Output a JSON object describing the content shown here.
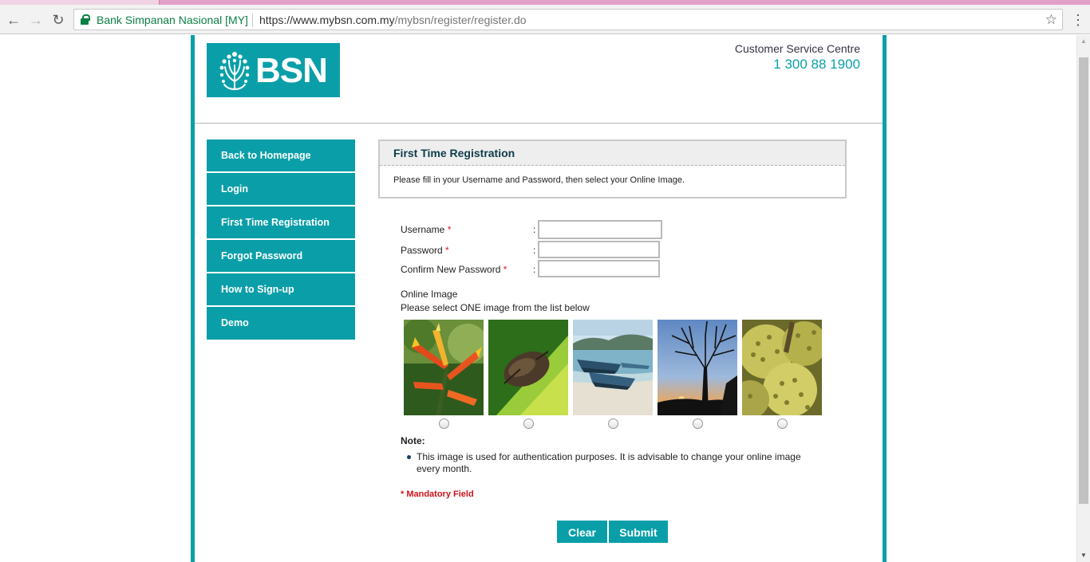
{
  "browser": {
    "site_name": "Bank Simpanan Nasional [MY]",
    "url_host": "https://www.mybsn.com.my",
    "url_path": "/mybsn/register/register.do",
    "back_icon": "arrow-left-icon",
    "forward_icon": "arrow-right-icon",
    "reload_icon": "reload-icon",
    "bookmark_icon": "star-icon",
    "menu_icon": "vertical-dots-icon",
    "secure_icon": "lock-icon"
  },
  "header": {
    "logo_text": "BSN",
    "cs_label": "Customer Service Centre",
    "cs_phone": "1 300 88 1900"
  },
  "sidebar": {
    "items": [
      {
        "label": "Back to Homepage"
      },
      {
        "label": "Login"
      },
      {
        "label": "First Time Registration"
      },
      {
        "label": "Forgot Password"
      },
      {
        "label": "How to Sign-up"
      },
      {
        "label": "Demo"
      }
    ]
  },
  "registration": {
    "title": "First Time Registration",
    "description": "Please fill in your Username and Password, then select your Online Image."
  },
  "form": {
    "username_label": "Username",
    "password_label": "Password",
    "confirm_label": "Confirm New Password",
    "required_mark": "*",
    "colon": ":",
    "username_value": "",
    "password_value": "",
    "confirm_value": ""
  },
  "online_image": {
    "title": "Online Image",
    "instruction": "Please select ONE image from the list below",
    "options": [
      "heliconia-flower",
      "moth-on-leaf",
      "boats-on-beach",
      "tree-at-sunset",
      "durian-fruit"
    ]
  },
  "note": {
    "title": "Note:",
    "text": "This image is used for authentication purposes. It is advisable to change your online image every month."
  },
  "mandatory_label": "* Mandatory Field",
  "buttons": {
    "clear": "Clear",
    "submit": "Submit"
  },
  "colors": {
    "brand_teal": "#0a9fa8",
    "required_red": "#e0191d"
  }
}
